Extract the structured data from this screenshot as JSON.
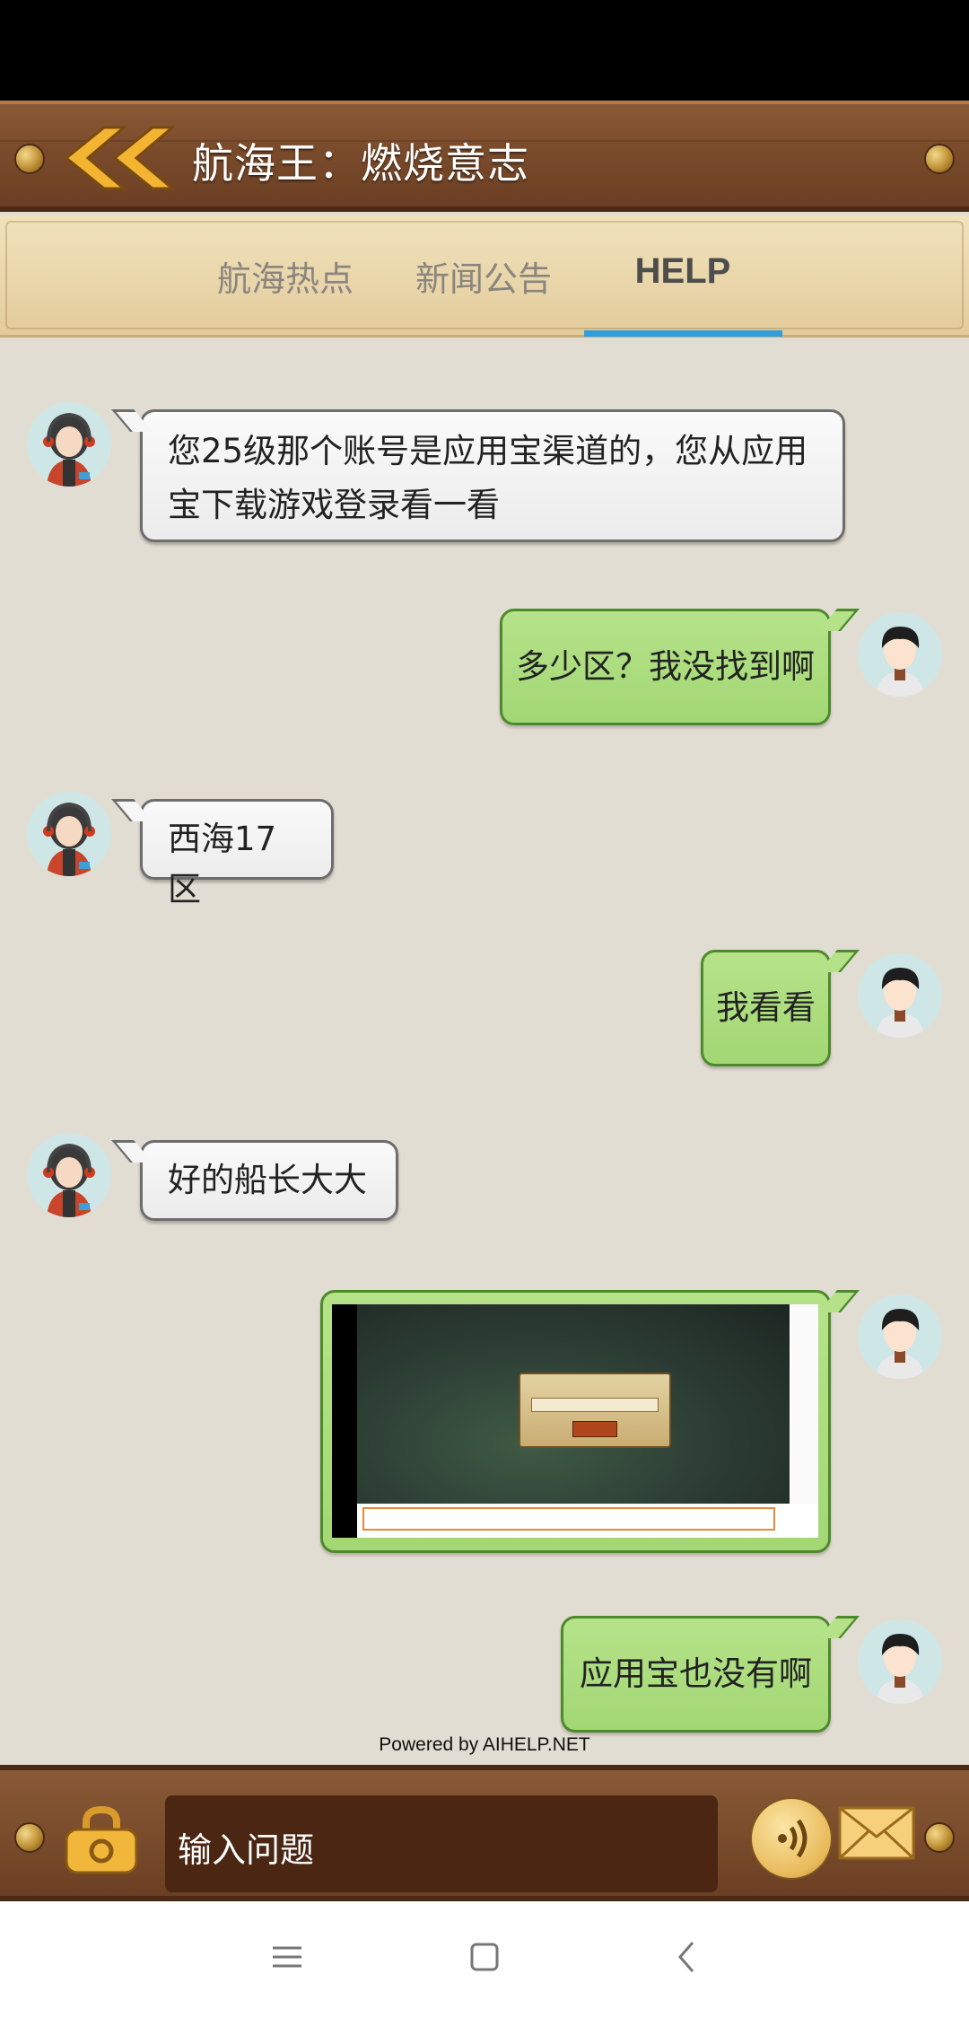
{
  "header": {
    "title": "航海王：燃烧意志"
  },
  "tabs": [
    {
      "label": "航海热点",
      "active": false
    },
    {
      "label": "新闻公告",
      "active": false
    },
    {
      "label": "HELP",
      "active": true
    }
  ],
  "messages": [
    {
      "from": "agent",
      "text": "您25级那个账号是应用宝渠道的，您从应用宝下载游戏登录看一看"
    },
    {
      "from": "user",
      "text": "多少区？我没找到啊"
    },
    {
      "from": "agent",
      "text": "西海17区"
    },
    {
      "from": "user",
      "text": "我看看"
    },
    {
      "from": "agent",
      "text": "好的船长大大"
    },
    {
      "from": "user",
      "type": "image"
    },
    {
      "from": "user",
      "text": "应用宝也没有啊"
    }
  ],
  "footer": {
    "powered": "Powered by AIHELP.NET"
  },
  "input": {
    "placeholder": "输入问题"
  },
  "colors": {
    "accent": "#2f9ee0",
    "user_bubble": "#a8db7a",
    "agent_bubble": "#f2f2f2",
    "wood": "#7a4b2b"
  },
  "icons": [
    "double-chevron-left-icon",
    "lock-icon",
    "voice-icon",
    "mail-icon",
    "menu-icon",
    "home-square-icon",
    "back-arrow-icon"
  ]
}
